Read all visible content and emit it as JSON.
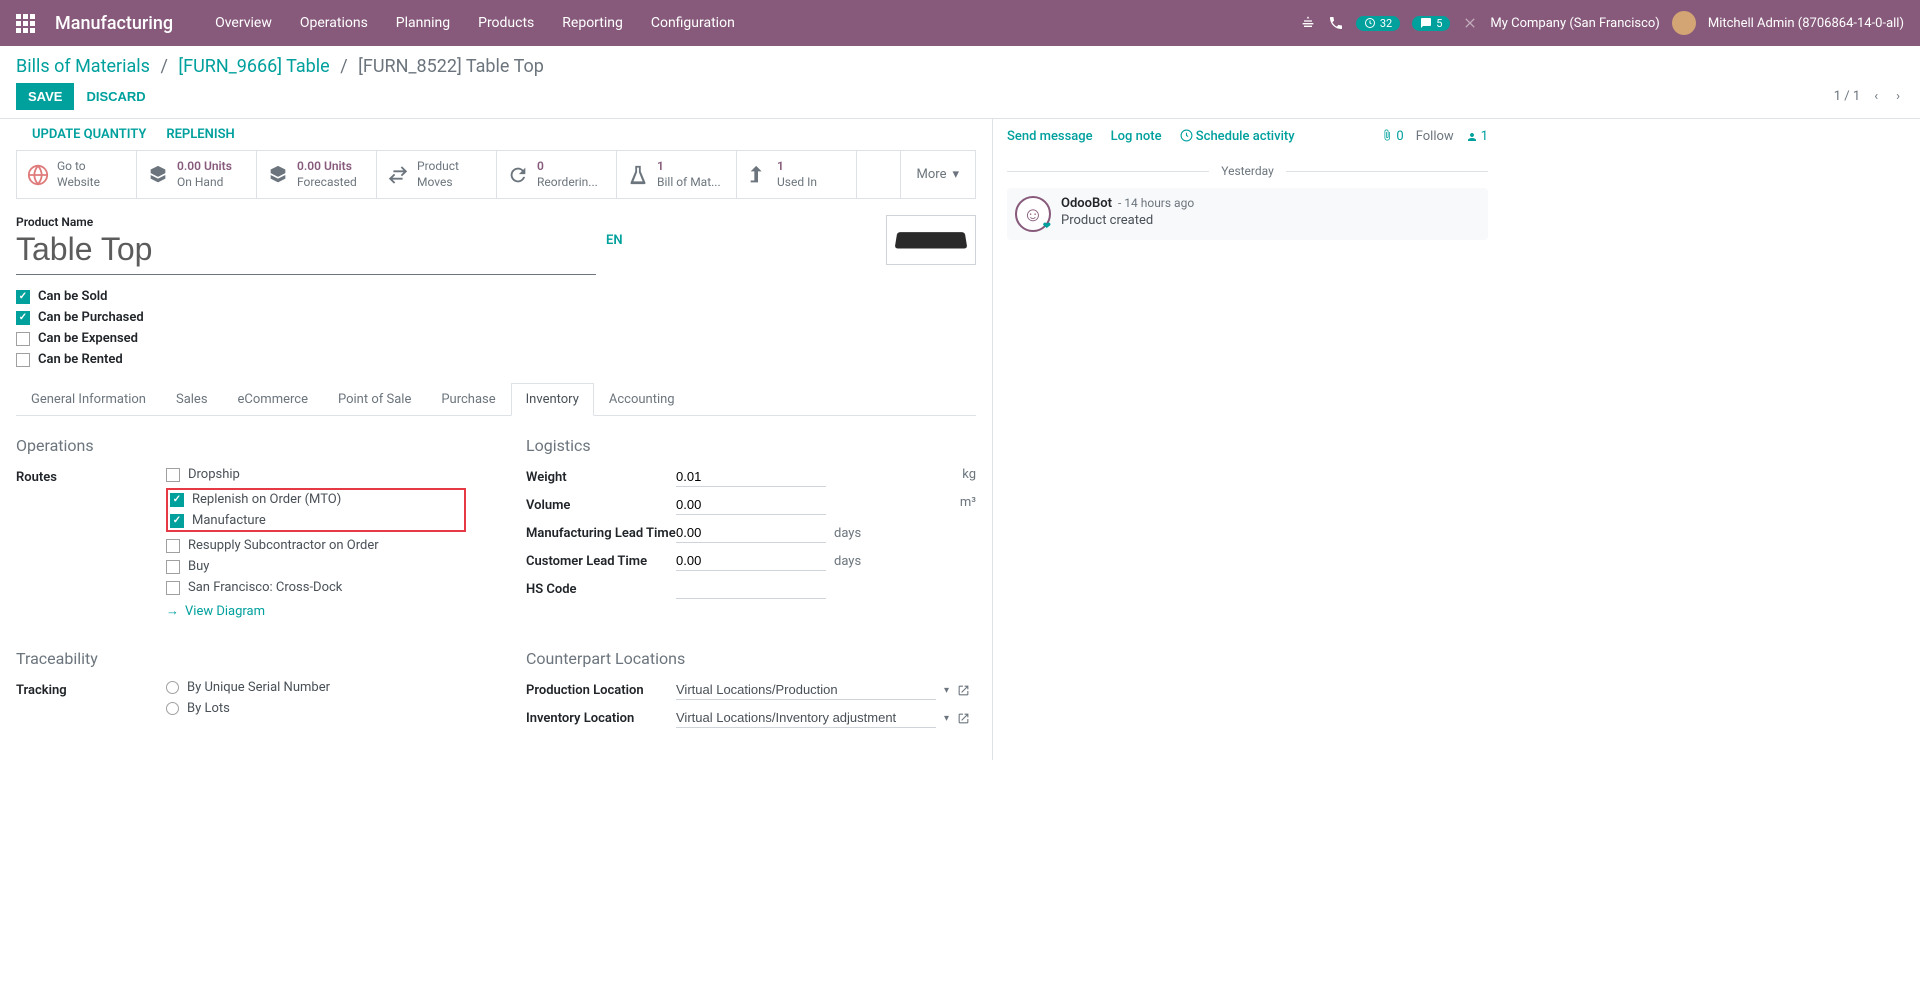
{
  "topnav": {
    "app_title": "Manufacturing",
    "menu": [
      "Overview",
      "Operations",
      "Planning",
      "Products",
      "Reporting",
      "Configuration"
    ],
    "badge1": "32",
    "badge2": "5",
    "company": "My Company (San Francisco)",
    "user": "Mitchell Admin (8706864-14-0-all)"
  },
  "breadcrumb": {
    "root": "Bills of Materials",
    "mid": "[FURN_9666] Table",
    "current": "[FURN_8522] Table Top"
  },
  "buttons": {
    "save": "SAVE",
    "discard": "DISCARD",
    "pager": "1 / 1",
    "update_qty": "UPDATE QUANTITY",
    "replenish": "REPLENISH"
  },
  "stat": {
    "website": {
      "line1": "Go to",
      "line2": "Website"
    },
    "onhand": {
      "value": "0.00 Units",
      "label": "On Hand"
    },
    "forecast": {
      "value": "0.00 Units",
      "label": "Forecasted"
    },
    "moves": {
      "line1": "Product",
      "line2": "Moves"
    },
    "reorder": {
      "value": "0",
      "label": "Reorderin..."
    },
    "bom": {
      "value": "1",
      "label": "Bill of Mat..."
    },
    "usedin": {
      "value": "1",
      "label": "Used In"
    },
    "more": "More"
  },
  "product": {
    "label": "Product Name",
    "name": "Table Top",
    "lang": "EN",
    "checks": {
      "sold": "Can be Sold",
      "purchased": "Can be Purchased",
      "expensed": "Can be Expensed",
      "rented": "Can be Rented"
    }
  },
  "tabs": [
    "General Information",
    "Sales",
    "eCommerce",
    "Point of Sale",
    "Purchase",
    "Inventory",
    "Accounting"
  ],
  "operations": {
    "title": "Operations",
    "routes_label": "Routes",
    "routes": {
      "dropship": "Dropship",
      "mto": "Replenish on Order (MTO)",
      "manufacture": "Manufacture",
      "resupply": "Resupply Subcontractor on Order",
      "buy": "Buy",
      "crossdock": "San Francisco: Cross-Dock"
    },
    "view_diagram": "View Diagram"
  },
  "logistics": {
    "title": "Logistics",
    "weight_label": "Weight",
    "weight_val": "0.01",
    "weight_unit": "kg",
    "volume_label": "Volume",
    "volume_val": "0.00",
    "volume_unit": "m³",
    "mlt_label": "Manufacturing Lead Time",
    "mlt_val": "0.00",
    "mlt_unit": "days",
    "clt_label": "Customer Lead Time",
    "clt_val": "0.00",
    "clt_unit": "days",
    "hs_label": "HS Code",
    "hs_val": ""
  },
  "traceability": {
    "title": "Traceability",
    "tracking_label": "Tracking",
    "opt_serial": "By Unique Serial Number",
    "opt_lots": "By Lots"
  },
  "counterpart": {
    "title": "Counterpart Locations",
    "prod_loc_label": "Production Location",
    "prod_loc_val": "Virtual Locations/Production",
    "inv_loc_label": "Inventory Location",
    "inv_loc_val": "Virtual Locations/Inventory adjustment"
  },
  "chatter": {
    "send": "Send message",
    "log": "Log note",
    "schedule": "Schedule activity",
    "attach": "0",
    "follow": "Follow",
    "followers": "1",
    "day": "Yesterday",
    "msg_author": "OdooBot",
    "msg_time": "- 14 hours ago",
    "msg_body": "Product created"
  }
}
